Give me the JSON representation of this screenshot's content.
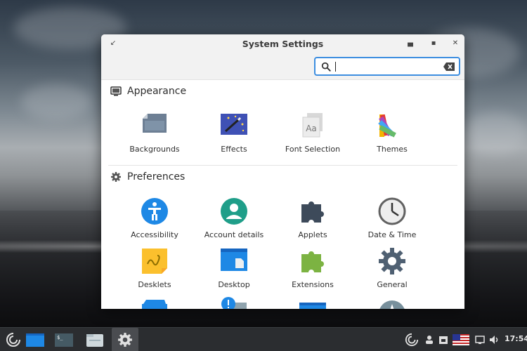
{
  "window": {
    "title": "System Settings",
    "search": {
      "value": "",
      "placeholder": ""
    }
  },
  "sections": [
    {
      "title": "Appearance",
      "icon": "monitor-icon",
      "items": [
        {
          "label": "Backgrounds",
          "icon": "backgrounds-icon"
        },
        {
          "label": "Effects",
          "icon": "effects-icon"
        },
        {
          "label": "Font Selection",
          "icon": "font-selection-icon"
        },
        {
          "label": "Themes",
          "icon": "themes-icon"
        }
      ]
    },
    {
      "title": "Preferences",
      "icon": "gear-icon",
      "items": [
        {
          "label": "Accessibility",
          "icon": "accessibility-icon"
        },
        {
          "label": "Account details",
          "icon": "account-icon"
        },
        {
          "label": "Applets",
          "icon": "applets-icon"
        },
        {
          "label": "Date & Time",
          "icon": "clock-icon"
        },
        {
          "label": "Desklets",
          "icon": "desklets-icon"
        },
        {
          "label": "Desktop",
          "icon": "desktop-icon"
        },
        {
          "label": "Extensions",
          "icon": "extensions-icon"
        },
        {
          "label": "General",
          "icon": "general-gear-icon"
        }
      ]
    }
  ],
  "taskbar": {
    "clock": "17:54",
    "tray_icons": [
      "cinnamon-icon",
      "user-icon",
      "lock-icon",
      "us-flag-icon",
      "display-icon",
      "volume-icon"
    ]
  },
  "colors": {
    "accent": "#3d8ee0",
    "taskbar": "#2b2d30"
  }
}
